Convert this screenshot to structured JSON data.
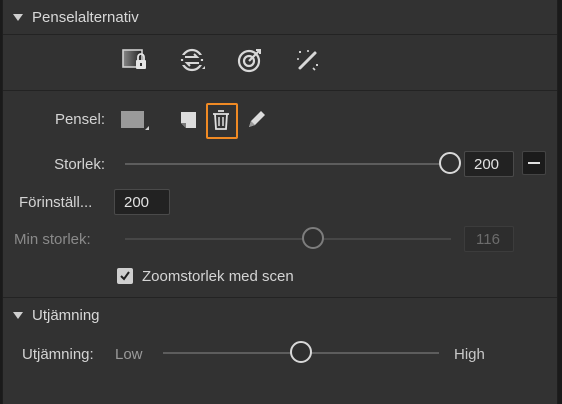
{
  "brush_options": {
    "title": "Penselalternativ",
    "tools": [
      {
        "icon": "masked-gradient-lock-icon"
      },
      {
        "icon": "brush-mode-swap-icon"
      },
      {
        "icon": "target-brush-icon"
      },
      {
        "icon": "magic-wand-brush-icon"
      }
    ],
    "brush_label": "Pensel:",
    "brush_icons": [
      "brush-preset-swatch-icon",
      "new-brush-preset-icon",
      "delete-brush-icon",
      "edit-brush-icon"
    ],
    "size_label": "Storlek:",
    "size_value": "200",
    "size_fraction": 1.0,
    "preset_label": "Förinställ...",
    "preset_value": "200",
    "min_size_label": "Min storlek:",
    "min_size_value": "116",
    "min_size_fraction": 0.58,
    "zoom_checkbox_label": "Zoomstorlek med scen",
    "zoom_checkbox_checked": true
  },
  "smoothing": {
    "title": "Utjämning",
    "label": "Utjämning:",
    "low_label": "Low",
    "high_label": "High",
    "value_fraction": 0.5
  },
  "colors": {
    "panel_bg": "#323232",
    "highlight": "#f08a24"
  }
}
